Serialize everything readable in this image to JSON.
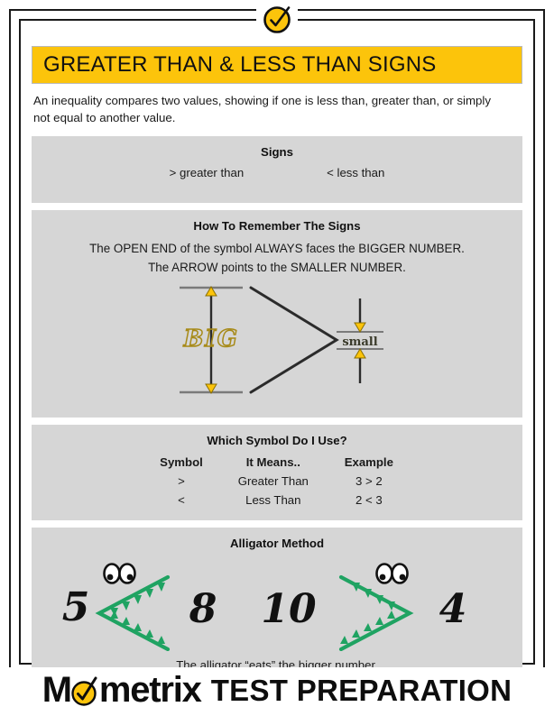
{
  "brand": {
    "badge_icon": "check-circle-icon",
    "accent_yellow": "#fcc40b",
    "panel_grey": "#d6d6d6",
    "alligator_green": "#1fa362",
    "big_label_gold": "#a78a18"
  },
  "header": {
    "title": "GREATER THAN & LESS THAN SIGNS"
  },
  "intro": {
    "text": "An inequality compares two values, showing if one is less than, greater than, or simply not equal to another value."
  },
  "signs_panel": {
    "title": "Signs",
    "items": [
      {
        "symbol": "> greater than"
      },
      {
        "symbol": "< less than"
      }
    ]
  },
  "remember_panel": {
    "title": "How To Remember The Signs",
    "line1": "The OPEN END of the symbol ALWAYS faces the BIGGER NUMBER.",
    "line2": "The ARROW points to the SMALLER NUMBER.",
    "diagram": {
      "big_label": "BIG",
      "small_label": "small"
    }
  },
  "symbol_panel": {
    "title": "Which Symbol Do I Use?",
    "columns": [
      "Symbol",
      "It Means..",
      "Example"
    ],
    "rows": [
      {
        "symbol": ">",
        "means": "Greater Than",
        "example": "3 > 2"
      },
      {
        "symbol": "<",
        "means": "Less Than",
        "example": "2 < 3"
      }
    ]
  },
  "alligator_panel": {
    "title": "Alligator Method",
    "examples": [
      {
        "left": "5",
        "right": "8",
        "relation": "less-than"
      },
      {
        "left": "10",
        "right": "4",
        "relation": "greater-than"
      }
    ],
    "caption": "The alligator “eats” the bigger number."
  },
  "footer": {
    "logo_pre": "M",
    "logo_post": "metrix",
    "logo_tail": "TEST PREPARATION"
  }
}
